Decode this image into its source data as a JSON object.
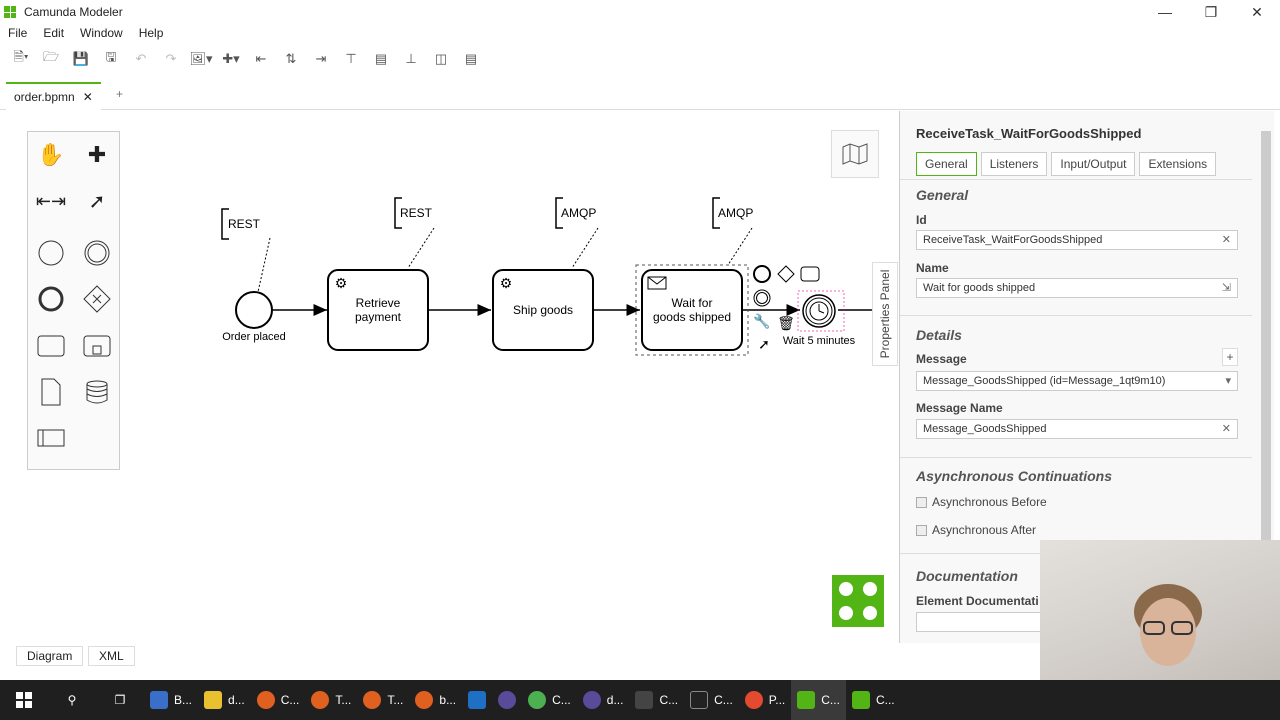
{
  "window": {
    "title": "Camunda Modeler"
  },
  "menu": [
    "File",
    "Edit",
    "Window",
    "Help"
  ],
  "tabs": {
    "file": "order.bpmn",
    "add": "+"
  },
  "diagram": {
    "start_event": "Order placed",
    "tasks": [
      "Retrieve payment",
      "Ship goods",
      "Wait for goods shipped"
    ],
    "annotations": [
      "REST",
      "REST",
      "AMQP",
      "AMQP"
    ],
    "timer": "Wait 5 minutes"
  },
  "properties": {
    "toggle": "Properties Panel",
    "element_id_title": "ReceiveTask_WaitForGoodsShipped",
    "tabs": [
      "General",
      "Listeners",
      "Input/Output",
      "Extensions"
    ],
    "general": {
      "heading": "General",
      "id_label": "Id",
      "id_value": "ReceiveTask_WaitForGoodsShipped",
      "name_label": "Name",
      "name_value": "Wait for goods shipped"
    },
    "details": {
      "heading": "Details",
      "message_label": "Message",
      "message_value": "Message_GoodsShipped (id=Message_1qt9m10)",
      "message_name_label": "Message Name",
      "message_name_value": "Message_GoodsShipped",
      "add": "+"
    },
    "async": {
      "heading": "Asynchronous Continuations",
      "before": "Asynchronous Before",
      "after": "Asynchronous After"
    },
    "documentation": {
      "heading": "Documentation",
      "label": "Element Documentati"
    }
  },
  "bottom_tabs": [
    "Diagram",
    "XML"
  ],
  "taskbar": [
    "B...",
    "d...",
    "C...",
    "T...",
    "T...",
    "b...",
    "d...",
    "C...",
    "C...",
    "C...",
    "P...",
    "C...",
    "C..."
  ],
  "colors": {
    "accent": "#52b415",
    "taskbar": "#1f1f1f"
  }
}
